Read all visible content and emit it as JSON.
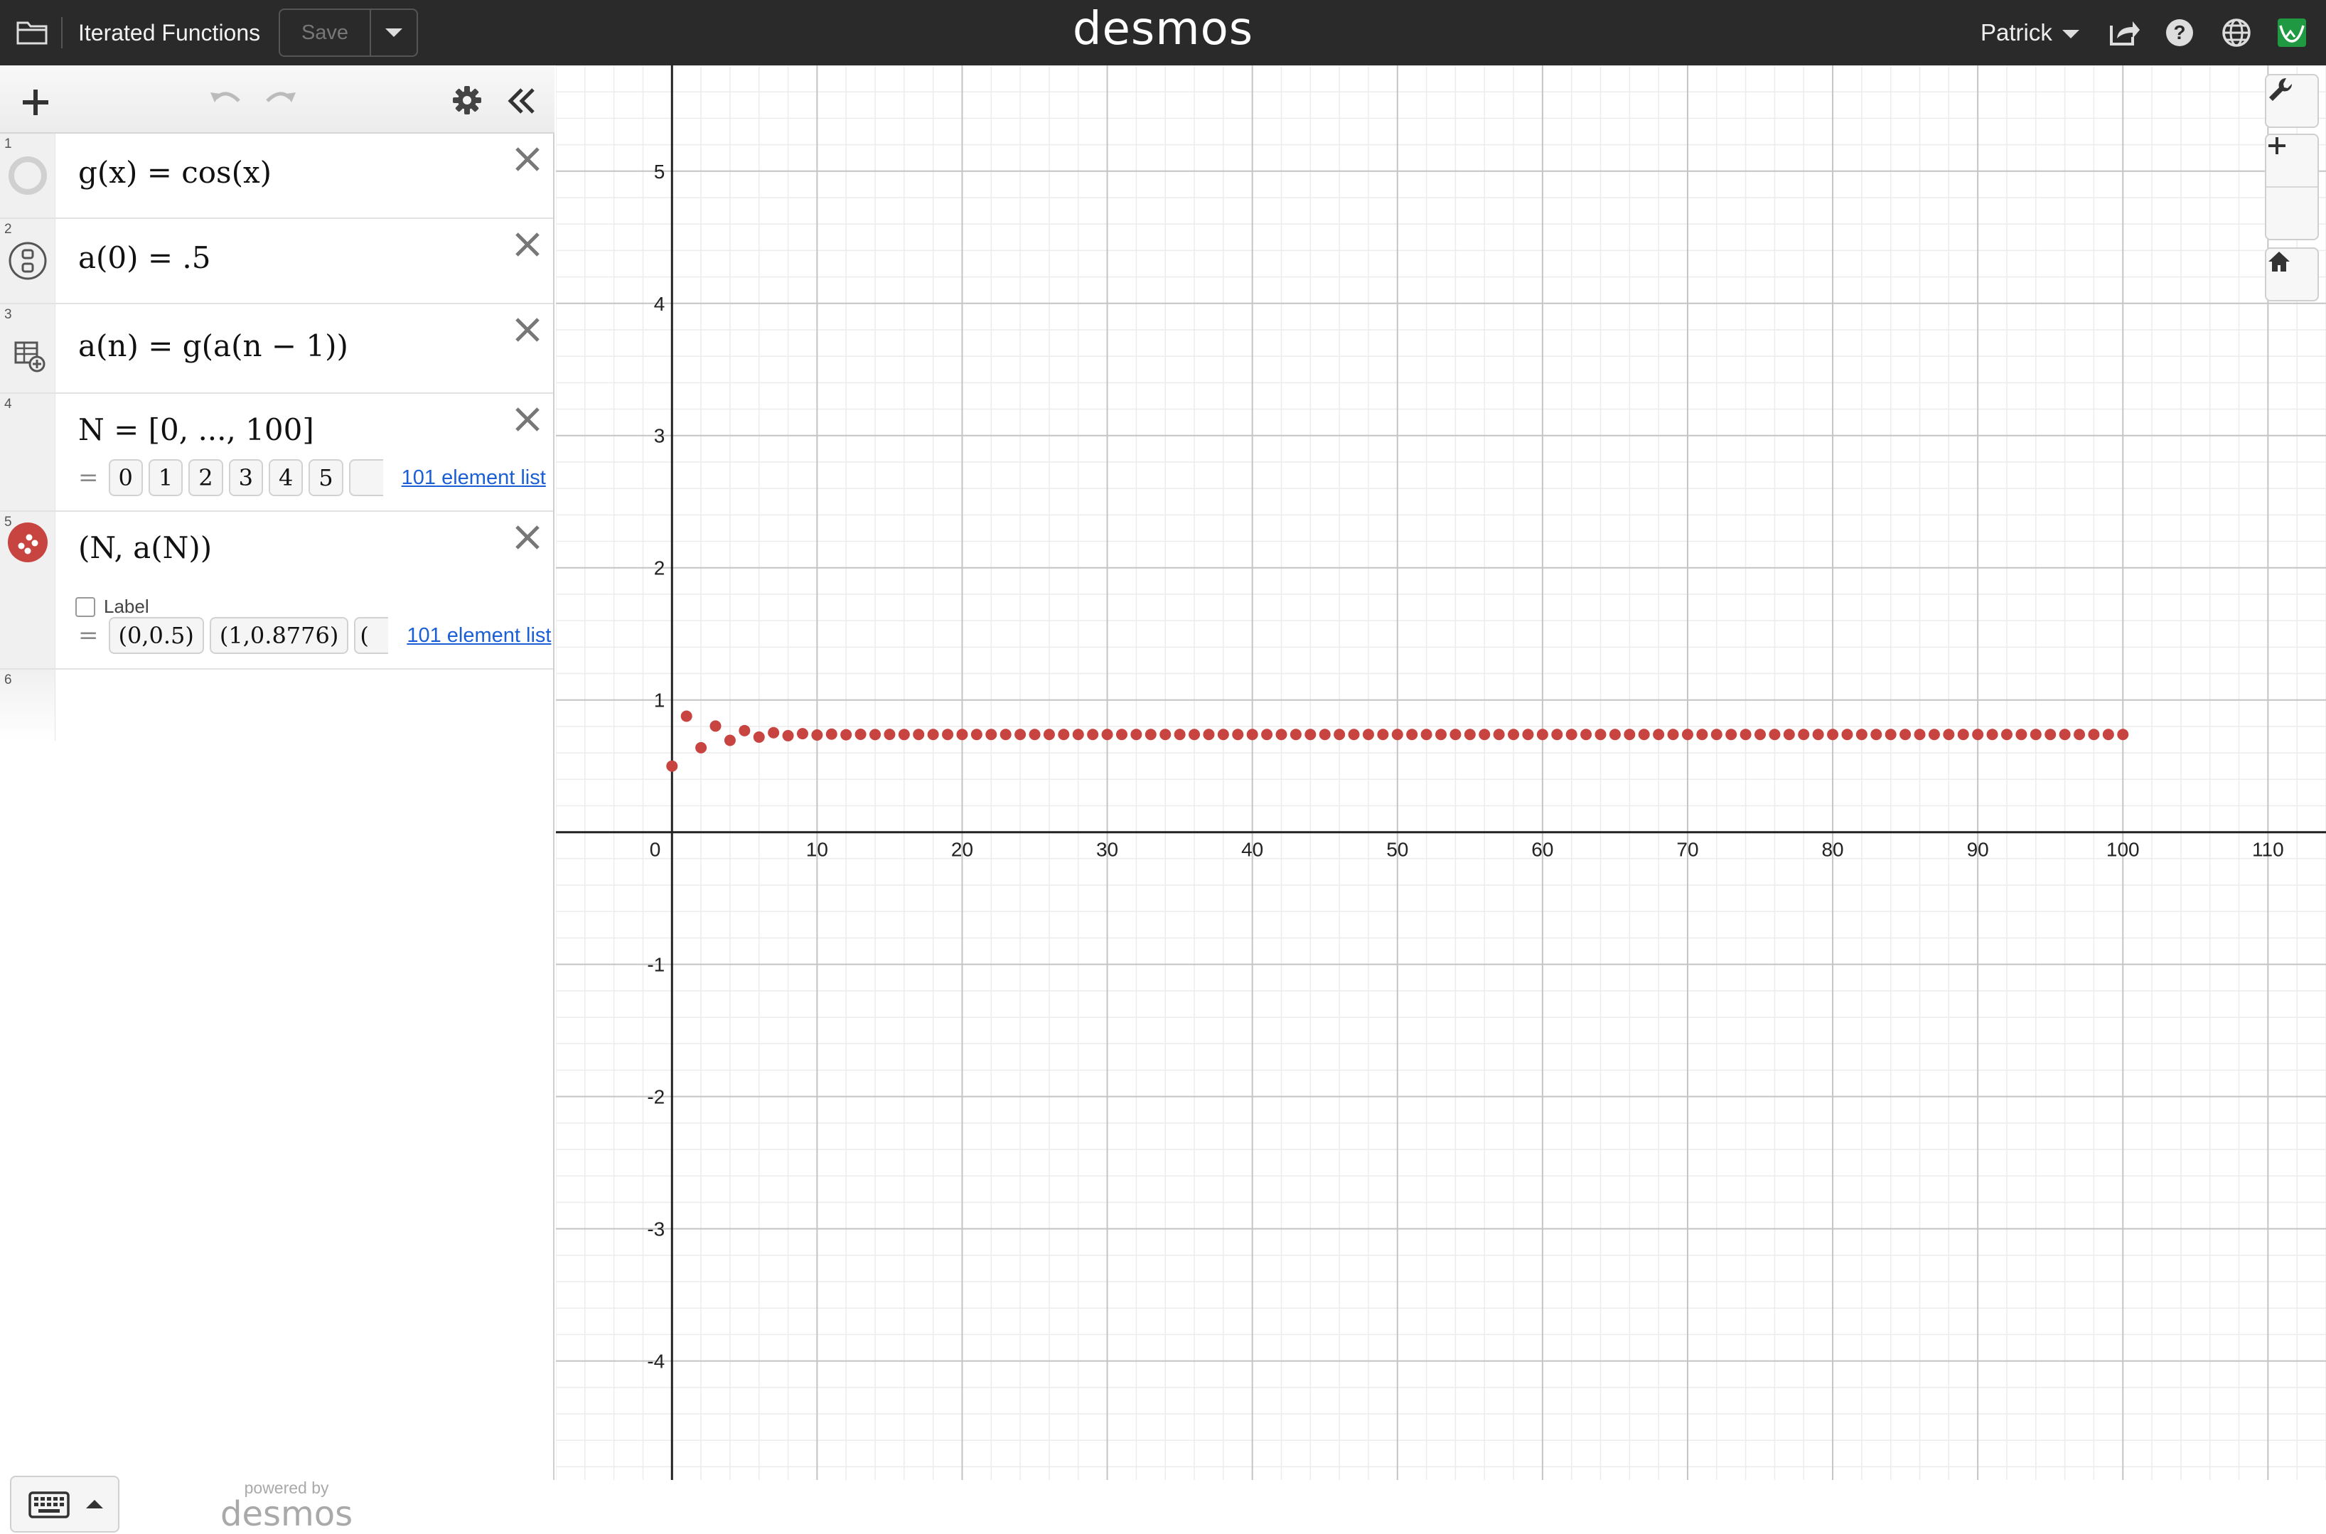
{
  "app": {
    "brand": "desmos",
    "document_title": "Iterated Functions",
    "save_label": "Save",
    "user_name": "Patrick",
    "icons": [
      "folder-icon",
      "share-icon",
      "help-icon",
      "language-icon",
      "account-icon"
    ]
  },
  "panel": {
    "icons": [
      "add-icon",
      "undo-icon",
      "redo-icon",
      "settings-icon",
      "collapse-icon"
    ],
    "keyboard_icon": "keyboard-icon",
    "powered_by": "powered by",
    "powered_brand": "desmos"
  },
  "expressions": [
    {
      "index": "1",
      "latex": "g(x) = cos(x)",
      "icon": "function-graph-circle"
    },
    {
      "index": "2",
      "latex": "a(0) = .5",
      "icon": "slider-icon"
    },
    {
      "index": "3",
      "latex": "a(n) = g(a(n − 1))",
      "icon": "add-table-icon"
    },
    {
      "index": "4",
      "latex": "N = [0, ..., 100]",
      "result_prefix": "=",
      "result_values": [
        "0",
        "1",
        "2",
        "3",
        "4",
        "5"
      ],
      "result_more": "101 element list"
    },
    {
      "index": "5",
      "latex": "(N, a(N))",
      "icon": "point-series-icon",
      "color": "#c74440",
      "label_checkbox": "Label",
      "label_checked": false,
      "result_prefix": "=",
      "result_values": [
        "(0,0.5)",
        "(1,0.8776)",
        "("
      ],
      "result_more": "101 element list"
    },
    {
      "index": "6",
      "latex": ""
    }
  ],
  "graph": {
    "x_ticks": [
      "0",
      "10",
      "20",
      "30",
      "40",
      "50",
      "60",
      "70",
      "80",
      "90",
      "100",
      "110"
    ],
    "y_ticks": [
      "5",
      "4",
      "3",
      "2",
      "1",
      "-1",
      "-2",
      "-3",
      "-4"
    ],
    "point_color": "#c74440",
    "grid": true,
    "tools": [
      "wrench-icon",
      "zoom-in-icon",
      "zoom-out-icon",
      "home-icon"
    ]
  },
  "chart_data": {
    "type": "scatter",
    "title": "",
    "xlabel": "",
    "ylabel": "",
    "xlim": [
      -8,
      114
    ],
    "ylim": [
      -4.9,
      5.8
    ],
    "series": [
      {
        "name": "",
        "x": [
          0,
          1,
          2,
          3,
          4,
          5,
          6,
          7,
          8,
          9,
          10,
          11,
          12,
          13,
          14,
          15,
          16,
          17,
          18,
          19,
          20,
          21,
          22,
          23,
          24,
          25,
          26,
          27,
          28,
          29,
          30,
          31,
          32,
          33,
          34,
          35,
          36,
          37,
          38,
          39,
          40,
          41,
          42,
          43,
          44,
          45,
          46,
          47,
          48,
          49,
          50,
          51,
          52,
          53,
          54,
          55,
          56,
          57,
          58,
          59,
          60,
          61,
          62,
          63,
          64,
          65,
          66,
          67,
          68,
          69,
          70,
          71,
          72,
          73,
          74,
          75,
          76,
          77,
          78,
          79,
          80,
          81,
          82,
          83,
          84,
          85,
          86,
          87,
          88,
          89,
          90,
          91,
          92,
          93,
          94,
          95,
          96,
          97,
          98,
          99,
          100
        ],
        "y": [
          0.5,
          0.8776,
          0.639,
          0.8027,
          0.6947,
          0.7682,
          0.7192,
          0.7523,
          0.7301,
          0.7451,
          0.735,
          0.7418,
          0.7372,
          0.7403,
          0.7382,
          0.7396,
          0.7387,
          0.7393,
          0.7389,
          0.7392,
          0.739,
          0.7391,
          0.7391,
          0.7391,
          0.7391,
          0.7391,
          0.7391,
          0.7391,
          0.7391,
          0.7391,
          0.7391,
          0.7391,
          0.7391,
          0.7391,
          0.7391,
          0.7391,
          0.7391,
          0.7391,
          0.7391,
          0.7391,
          0.7391,
          0.7391,
          0.7391,
          0.7391,
          0.7391,
          0.7391,
          0.7391,
          0.7391,
          0.7391,
          0.7391,
          0.7391,
          0.7391,
          0.7391,
          0.7391,
          0.7391,
          0.7391,
          0.7391,
          0.7391,
          0.7391,
          0.7391,
          0.7391,
          0.7391,
          0.7391,
          0.7391,
          0.7391,
          0.7391,
          0.7391,
          0.7391,
          0.7391,
          0.7391,
          0.7391,
          0.7391,
          0.7391,
          0.7391,
          0.7391,
          0.7391,
          0.7391,
          0.7391,
          0.7391,
          0.7391,
          0.7391,
          0.7391,
          0.7391,
          0.7391,
          0.7391,
          0.7391,
          0.7391,
          0.7391,
          0.7391,
          0.7391,
          0.7391,
          0.7391,
          0.7391,
          0.7391,
          0.7391,
          0.7391,
          0.7391,
          0.7391,
          0.7391,
          0.7391,
          0.7391
        ]
      }
    ]
  }
}
